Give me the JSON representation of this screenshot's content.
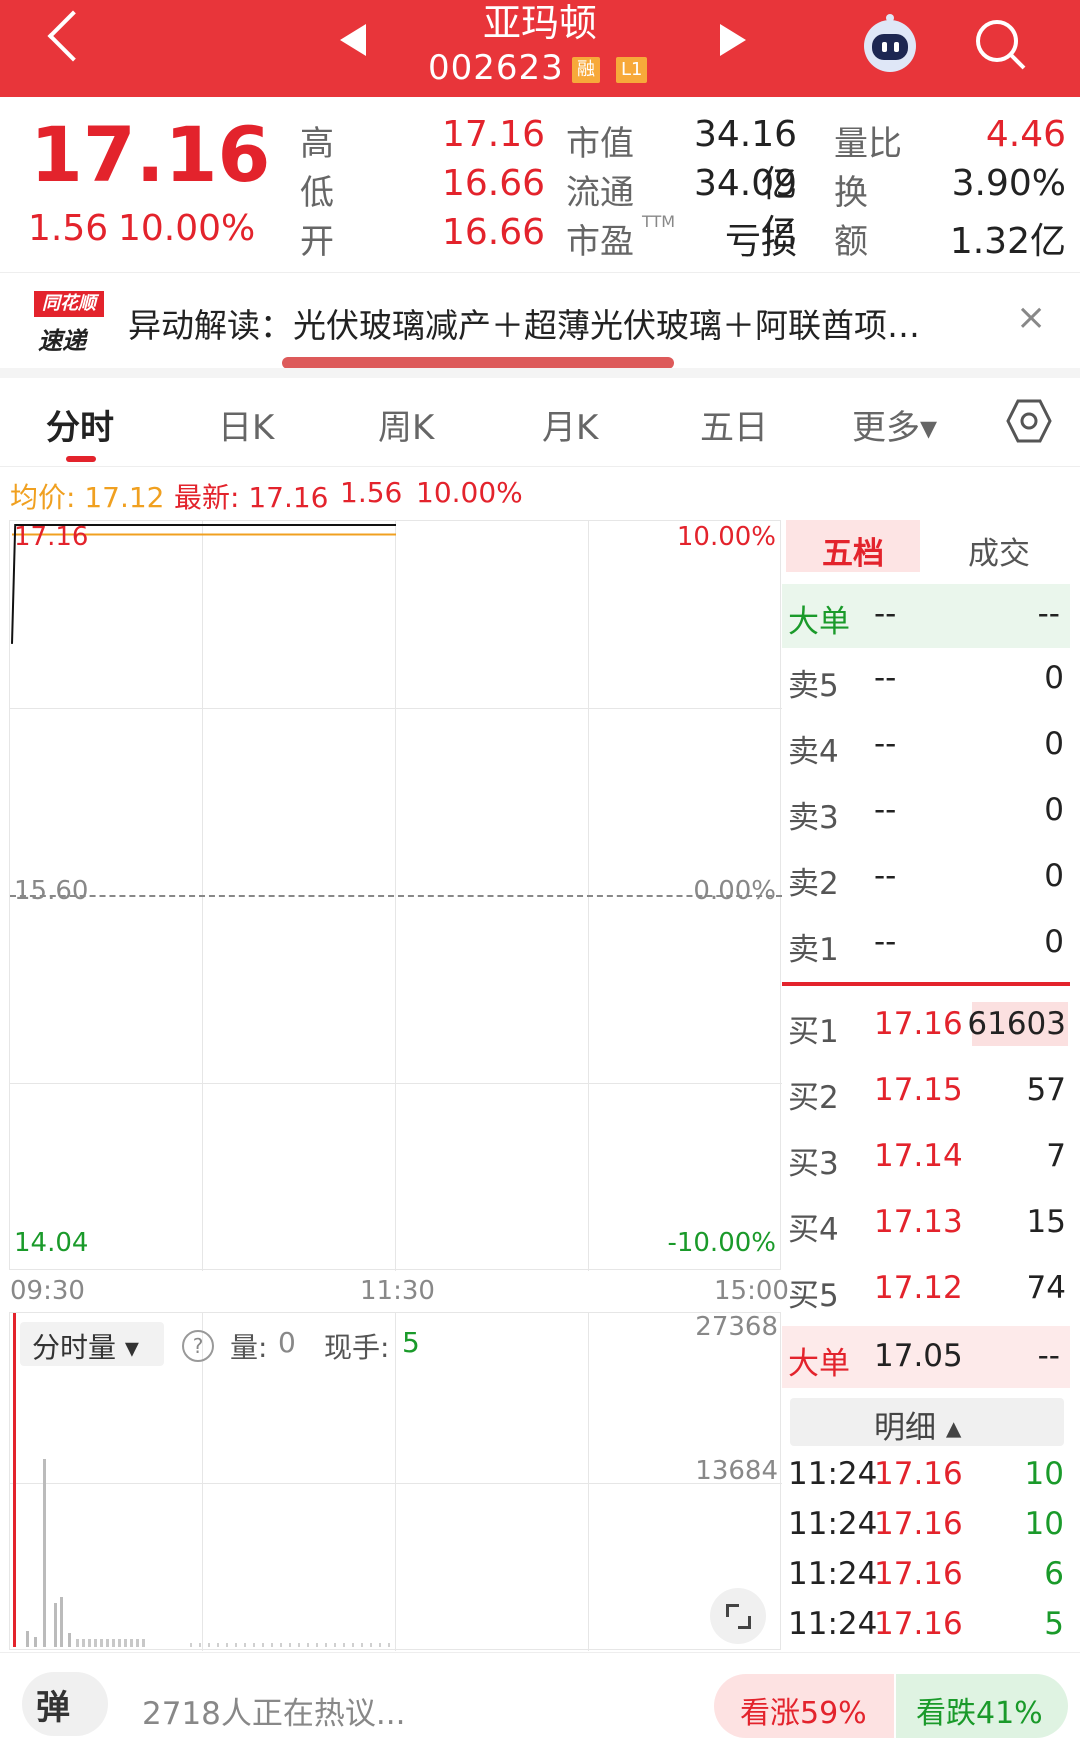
{
  "header": {
    "title": "亚玛顿",
    "code": "002623",
    "badge_margin": "融",
    "badge_level": "L1"
  },
  "quote": {
    "price": "17.16",
    "change": "1.56",
    "change_pct": "10.00%",
    "high_label": "高",
    "high": "17.16",
    "low_label": "低",
    "low": "16.66",
    "open_label": "开",
    "open": "16.66",
    "mcap_label": "市值",
    "mcap": "34.16亿",
    "float_label": "流通",
    "float": "34.09亿",
    "pe_label": "市盈",
    "pe_sup": "TTM",
    "pe": "亏损",
    "vr_label": "量比",
    "vr": "4.46",
    "turnover_label": "换",
    "turnover": "3.90%",
    "amount_label": "额",
    "amount": "1.32亿"
  },
  "news": {
    "logo_top": "同花顺",
    "logo_bottom": "速递",
    "text": "异动解读：光伏玻璃减产＋超薄光伏玻璃＋阿联酋项…",
    "close": "×"
  },
  "tabs": [
    "分时",
    "日K",
    "周K",
    "月K",
    "五日",
    "更多▾"
  ],
  "legend": {
    "avg": "均价: 17.12",
    "latest": "最新: 17.16",
    "chg": "1.56",
    "pct": "10.00%"
  },
  "chart_data": {
    "type": "line",
    "y_top_label": "17.16",
    "y_mid_label": "15.60",
    "y_bottom_label": "14.04",
    "pct_top_label": "10.00%",
    "pct_mid_label": "0.00%",
    "pct_bottom_label": "-10.00%",
    "x_labels": [
      "09:30",
      "11:30",
      "15:00"
    ],
    "ylim": [
      14.04,
      17.16
    ],
    "price_series": {
      "x": [
        "09:30",
        "09:31",
        "11:30"
      ],
      "values": [
        16.66,
        17.16,
        17.16
      ]
    },
    "avg_series": {
      "x": [
        "09:30",
        "11:30"
      ],
      "values": [
        17.12,
        17.12
      ]
    }
  },
  "volume": {
    "selector": "分时量 ▾",
    "help": "?",
    "vol_label": "量:",
    "vol_value": "0",
    "hand_label": "现手:",
    "hand_value": "5",
    "y_top": "27368",
    "y_mid": "13684"
  },
  "order_book": {
    "tab_active": "五档",
    "tab_inactive": "成交",
    "big_top": {
      "label": "大单",
      "price": "--",
      "vol": "--"
    },
    "asks": [
      {
        "label": "卖5",
        "price": "--",
        "vol": "0"
      },
      {
        "label": "卖4",
        "price": "--",
        "vol": "0"
      },
      {
        "label": "卖3",
        "price": "--",
        "vol": "0"
      },
      {
        "label": "卖2",
        "price": "--",
        "vol": "0"
      },
      {
        "label": "卖1",
        "price": "--",
        "vol": "0"
      }
    ],
    "bids": [
      {
        "label": "买1",
        "price": "17.16",
        "vol": "61603"
      },
      {
        "label": "买2",
        "price": "17.15",
        "vol": "57"
      },
      {
        "label": "买3",
        "price": "17.14",
        "vol": "7"
      },
      {
        "label": "买4",
        "price": "17.13",
        "vol": "15"
      },
      {
        "label": "买5",
        "price": "17.12",
        "vol": "74"
      }
    ],
    "big_bottom": {
      "label": "大单",
      "price": "17.05",
      "vol": "--"
    },
    "detail_label": "明细 ▴",
    "details": [
      {
        "time": "11:24",
        "price": "17.16",
        "vol": "10"
      },
      {
        "time": "11:24",
        "price": "17.16",
        "vol": "10"
      },
      {
        "time": "11:24",
        "price": "17.16",
        "vol": "6"
      },
      {
        "time": "11:24",
        "price": "17.16",
        "vol": "5"
      }
    ]
  },
  "footer": {
    "danmu": "弹",
    "discuss": "2718人正在热议...",
    "bull": "看涨59%",
    "bear": "看跌41%"
  }
}
